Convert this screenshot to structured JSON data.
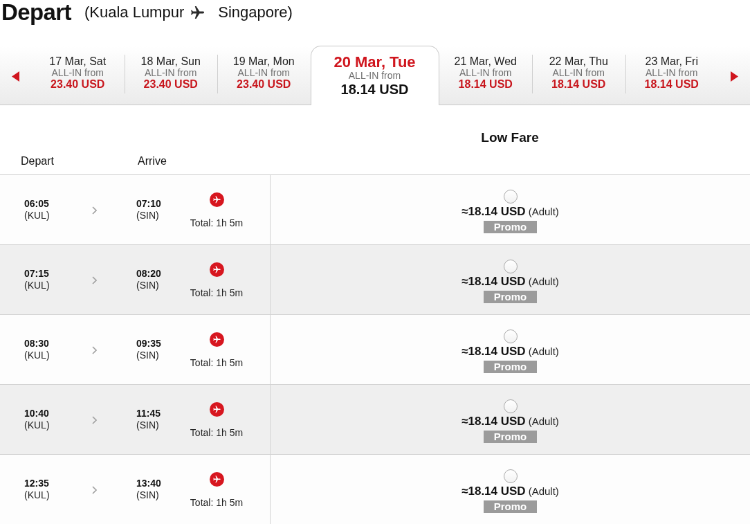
{
  "header": {
    "title": "Depart",
    "origin": "(Kuala Lumpur",
    "destination": "Singapore)"
  },
  "dates": [
    {
      "date": "17 Mar, Sat",
      "caption": "ALL-IN from",
      "price": "23.40 USD",
      "selected": false
    },
    {
      "date": "18 Mar, Sun",
      "caption": "ALL-IN from",
      "price": "23.40 USD",
      "selected": false
    },
    {
      "date": "19 Mar, Mon",
      "caption": "ALL-IN from",
      "price": "23.40 USD",
      "selected": false
    },
    {
      "date": "20 Mar, Tue",
      "caption": "ALL-IN from",
      "price": "18.14 USD",
      "selected": true
    },
    {
      "date": "21 Mar, Wed",
      "caption": "ALL-IN from",
      "price": "18.14 USD",
      "selected": false
    },
    {
      "date": "22 Mar, Thu",
      "caption": "ALL-IN from",
      "price": "18.14 USD",
      "selected": false
    },
    {
      "date": "23 Mar, Fri",
      "caption": "ALL-IN from",
      "price": "18.14 USD",
      "selected": false
    }
  ],
  "table": {
    "fare_class": "Low Fare",
    "depart_heading": "Depart",
    "arrive_heading": "Arrive"
  },
  "flights": [
    {
      "depart_time": "06:05",
      "depart_airport": "(KUL)",
      "arrive_time": "07:10",
      "arrive_airport": "(SIN)",
      "duration": "Total: 1h 5m",
      "fare": {
        "selected": false,
        "price": "≈18.14 USD",
        "passenger": "(Adult)",
        "badge": "Promo"
      }
    },
    {
      "depart_time": "07:15",
      "depart_airport": "(KUL)",
      "arrive_time": "08:20",
      "arrive_airport": "(SIN)",
      "duration": "Total: 1h 5m",
      "fare": {
        "selected": false,
        "price": "≈18.14 USD",
        "passenger": "(Adult)",
        "badge": "Promo"
      }
    },
    {
      "depart_time": "08:30",
      "depart_airport": "(KUL)",
      "arrive_time": "09:35",
      "arrive_airport": "(SIN)",
      "duration": "Total: 1h 5m",
      "fare": {
        "selected": false,
        "price": "≈18.14 USD",
        "passenger": "(Adult)",
        "badge": "Promo"
      }
    },
    {
      "depart_time": "10:40",
      "depart_airport": "(KUL)",
      "arrive_time": "11:45",
      "arrive_airport": "(SIN)",
      "duration": "Total: 1h 5m",
      "fare": {
        "selected": false,
        "price": "≈18.14 USD",
        "passenger": "(Adult)",
        "badge": "Promo"
      }
    },
    {
      "depart_time": "12:35",
      "depart_airport": "(KUL)",
      "arrive_time": "13:40",
      "arrive_airport": "(SIN)",
      "duration": "Total: 1h 5m",
      "fare": {
        "selected": false,
        "price": "≈18.14 USD",
        "passenger": "(Adult)",
        "badge": "Promo"
      }
    }
  ]
}
